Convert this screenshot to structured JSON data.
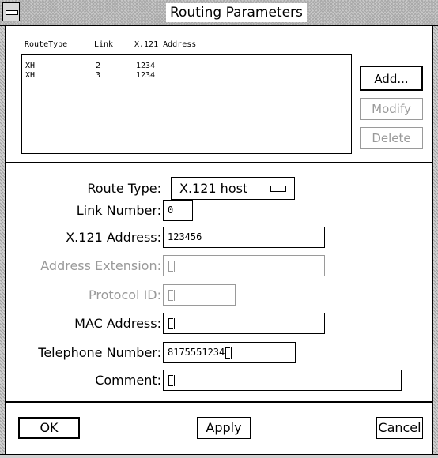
{
  "window": {
    "title": "Routing Parameters"
  },
  "route_list": {
    "headers": {
      "route_type": "RouteType",
      "link": "Link",
      "address": "X.121 Address"
    },
    "rows": [
      {
        "route_type": "XH",
        "link": "2",
        "address": "1234"
      },
      {
        "route_type": "XH",
        "link": "3",
        "address": "1234"
      }
    ]
  },
  "list_buttons": {
    "add": "Add...",
    "modify": "Modify",
    "delete": "Delete"
  },
  "form": {
    "route_type": {
      "label": "Route Type:",
      "value": "X.121 host"
    },
    "link_number": {
      "label": "Link Number:",
      "value": "0"
    },
    "x121_address": {
      "label": "X.121 Address:",
      "value": "123456"
    },
    "address_extension": {
      "label": "Address Extension:",
      "value": ""
    },
    "protocol_id": {
      "label": "Protocol ID:",
      "value": ""
    },
    "mac_address": {
      "label": "MAC Address:",
      "value": ""
    },
    "telephone_number": {
      "label": "Telephone Number:",
      "value": "8175551234"
    },
    "comment": {
      "label": "Comment:",
      "value": ""
    }
  },
  "actions": {
    "ok": "OK",
    "apply": "Apply",
    "cancel": "Cancel"
  }
}
